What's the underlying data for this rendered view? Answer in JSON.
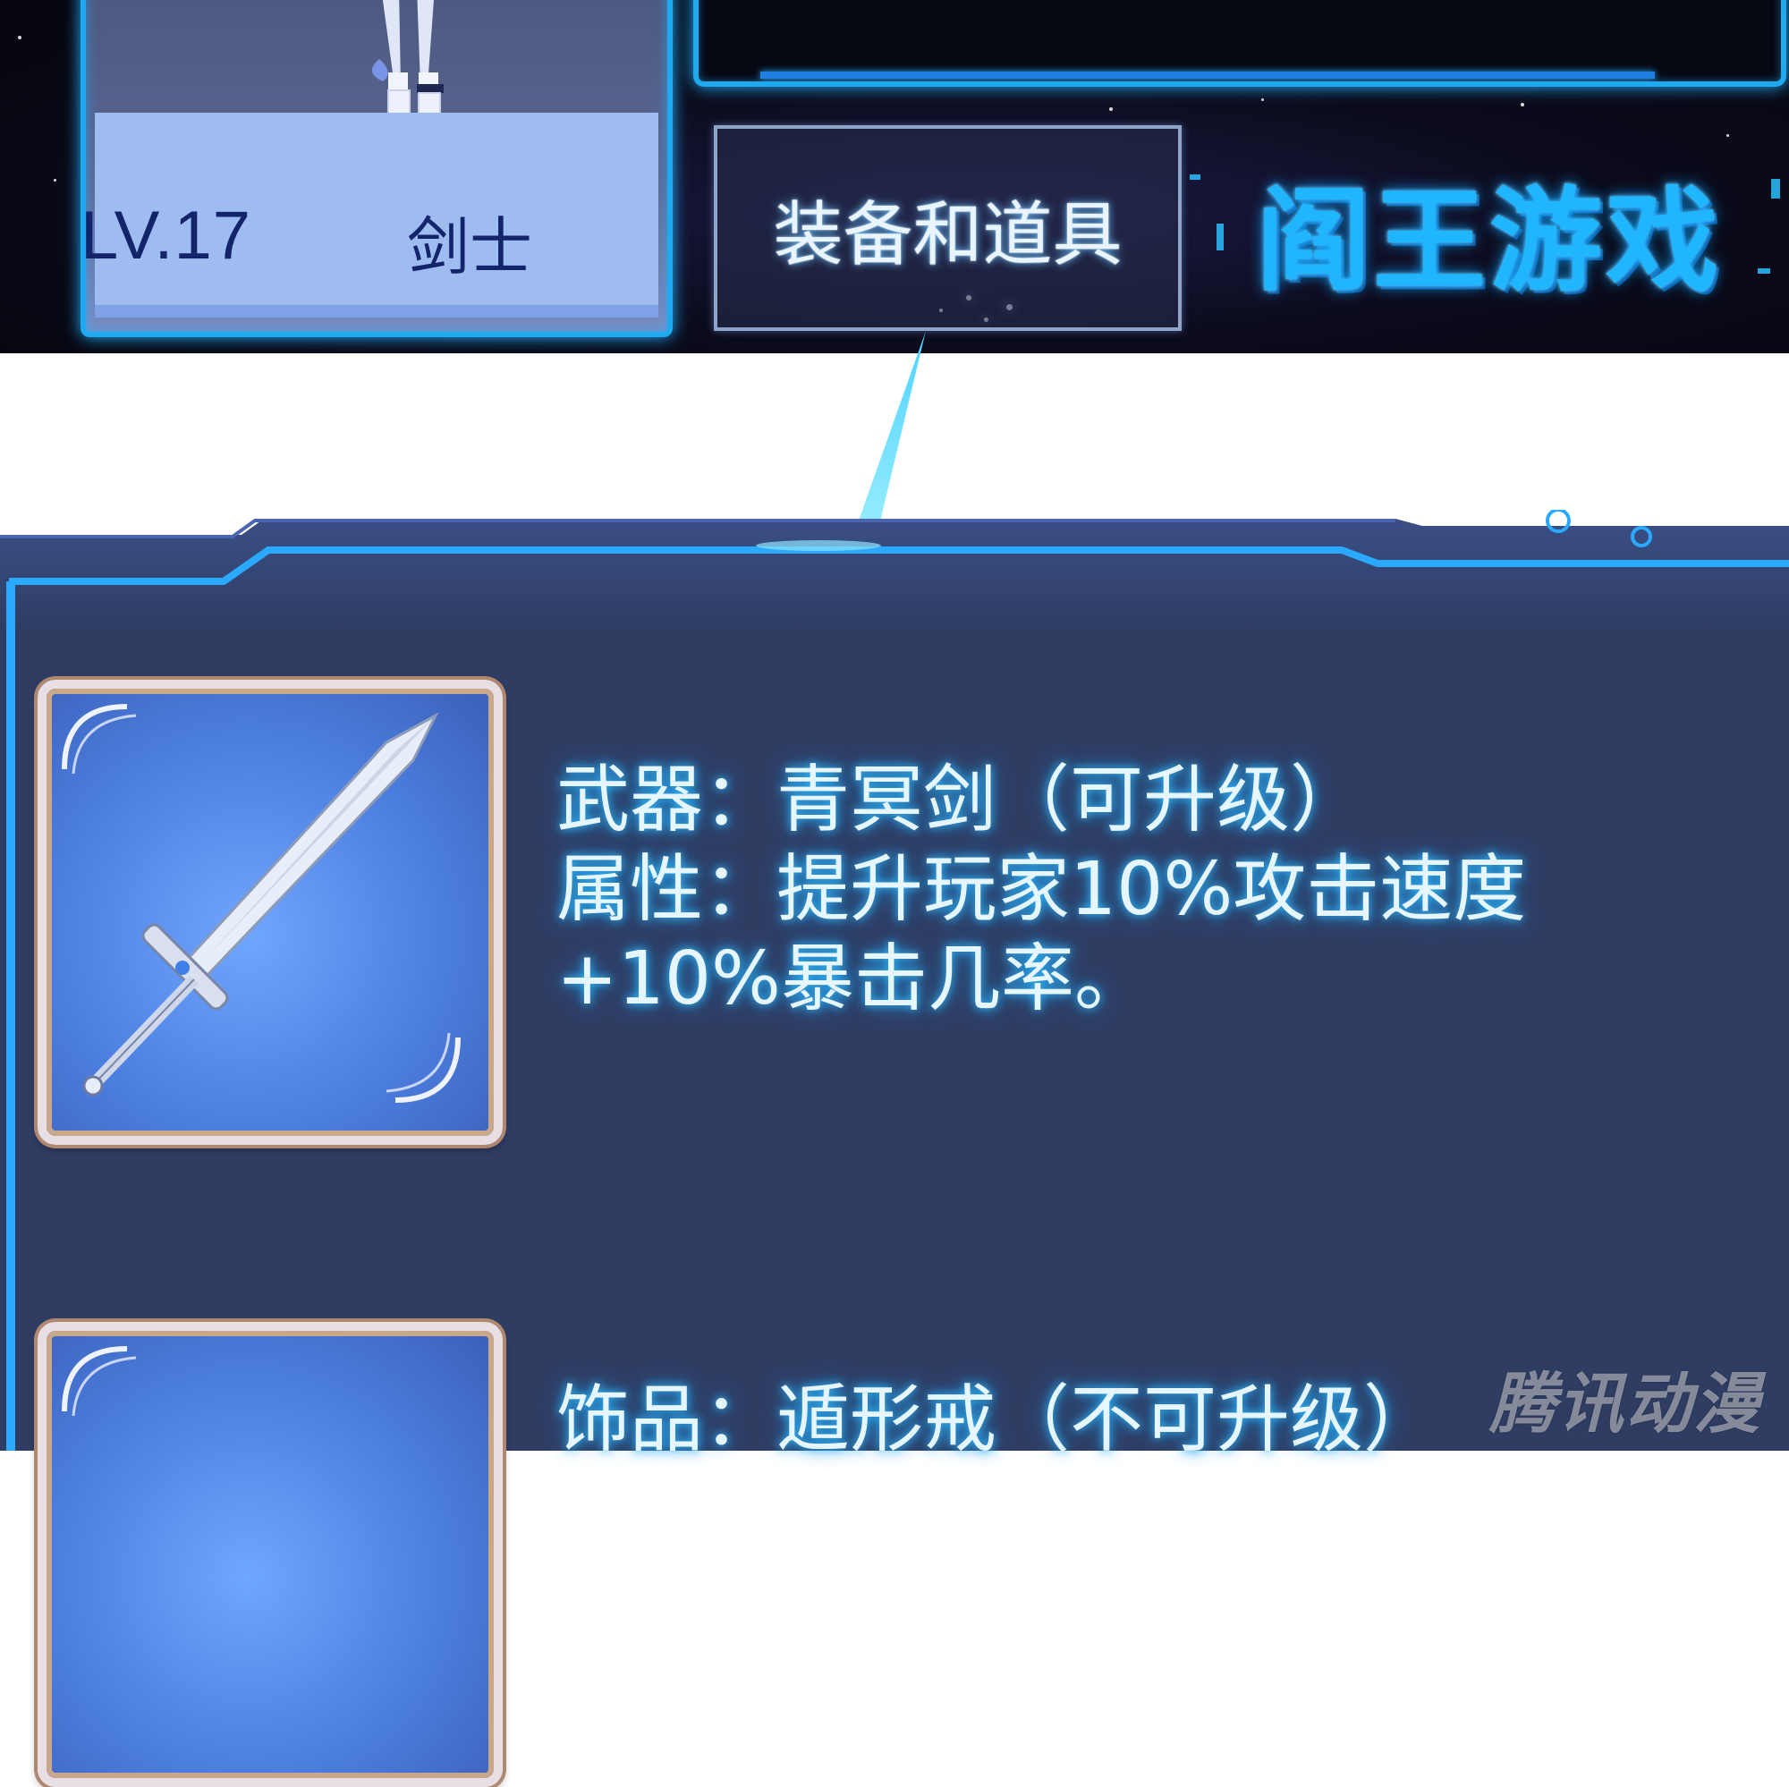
{
  "character": {
    "level": "LV.17",
    "class": "剑士"
  },
  "menu": {
    "tab_label": "装备和道具"
  },
  "game": {
    "title": "阎王游戏"
  },
  "items": [
    {
      "line1": "武器：青冥剑（可升级）",
      "line2": "属性：提升玩家10%攻击速度",
      "line3": "+10%暴击几率。",
      "icon": "sword-icon"
    },
    {
      "line1": "饰品：遁形戒（不可升级）",
      "icon": "ring-icon"
    }
  ],
  "watermark": "腾讯动漫",
  "colors": {
    "accent_cyan": "#1fa9ee",
    "panel_bg": "#2f3d63",
    "text_glow": "#33bdff",
    "level_text": "#14246a"
  }
}
